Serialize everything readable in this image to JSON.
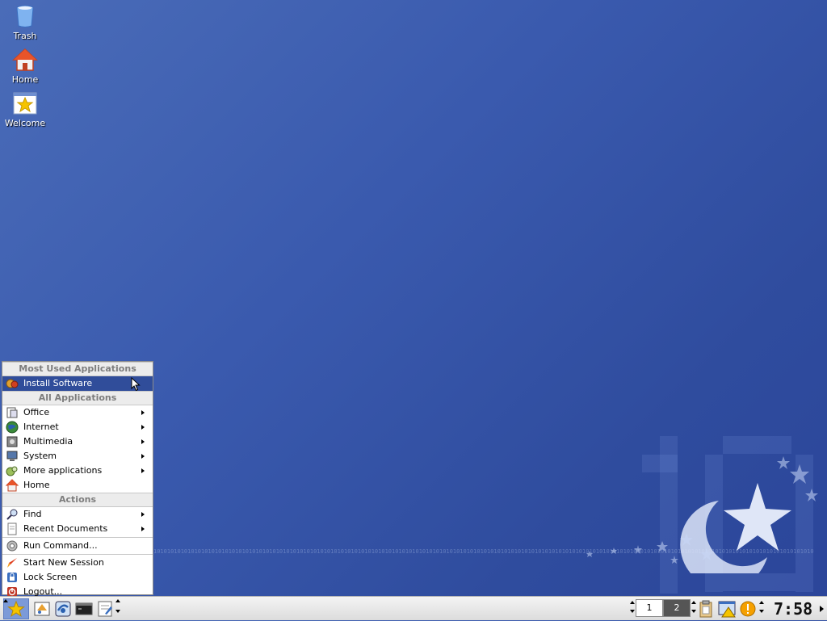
{
  "desktop": {
    "icons": [
      {
        "label": "Trash",
        "icon": "trash-icon"
      },
      {
        "label": "Home",
        "icon": "home-icon"
      },
      {
        "label": "Welcome",
        "icon": "welcome-star-icon"
      }
    ]
  },
  "kmenu": {
    "sections": {
      "most_used": "Most Used Applications",
      "all_apps": "All Applications",
      "actions": "Actions"
    },
    "most_used_items": [
      {
        "label": "Install Software",
        "icon": "install-software-icon",
        "selected": true
      }
    ],
    "app_items": [
      {
        "label": "Office",
        "icon": "office-icon",
        "submenu": true
      },
      {
        "label": "Internet",
        "icon": "globe-icon",
        "submenu": true
      },
      {
        "label": "Multimedia",
        "icon": "multimedia-icon",
        "submenu": true
      },
      {
        "label": "System",
        "icon": "system-icon",
        "submenu": true
      },
      {
        "label": "More applications",
        "icon": "more-apps-icon",
        "submenu": true
      },
      {
        "label": "Home",
        "icon": "home-icon",
        "submenu": false
      }
    ],
    "action_items": [
      {
        "label": "Find",
        "icon": "find-icon",
        "submenu": true
      },
      {
        "label": "Recent Documents",
        "icon": "document-icon",
        "submenu": true
      },
      {
        "label": "Run Command...",
        "icon": "gear-icon",
        "submenu": false
      },
      {
        "label": "Start New Session",
        "icon": "rocket-icon",
        "submenu": false
      },
      {
        "label": "Lock Screen",
        "icon": "lock-icon",
        "submenu": false
      },
      {
        "label": "Logout...",
        "icon": "logout-icon",
        "submenu": false
      }
    ]
  },
  "taskbar": {
    "pager": [
      "1",
      "2"
    ],
    "active_desktop": "2",
    "clock": "7:58"
  },
  "colors": {
    "desktop_bg": "#3a5aae",
    "menu_selection": "#304d9a",
    "menu_header_text": "#7d7d7d"
  }
}
